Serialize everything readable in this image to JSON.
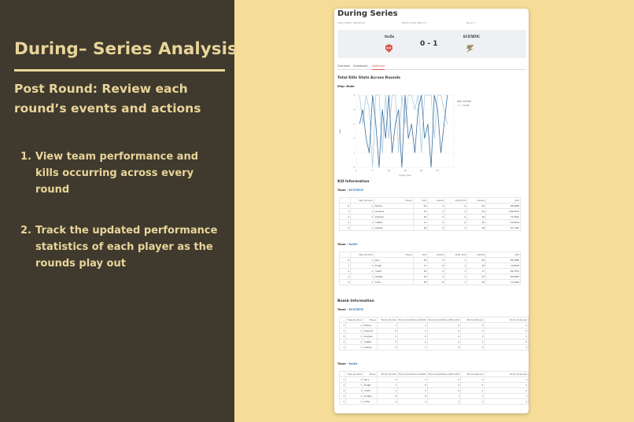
{
  "slide": {
    "title": "During– Series Analysis",
    "subtitle": "Post Round: Review each round’s events and actions",
    "bullets": [
      {
        "num": "1.",
        "text": "View team performance and kills occurring across every round"
      },
      {
        "num": "2.",
        "text": "Track the updated performance statistics of each player as the rounds play out"
      }
    ]
  },
  "app": {
    "page_title": "During Series",
    "meta": [
      "Date of Match: 2023-03-20",
      "Match Format: Best of 3",
      "Round: 3"
    ],
    "match": {
      "team1": "forZe",
      "team2": "ECSTATIC",
      "score": "0 - 1"
    },
    "tabs": [
      {
        "label": "Overhead",
        "active": false
      },
      {
        "label": "Scoreboard",
        "active": false
      },
      {
        "label": "Heatmaps",
        "active": true
      }
    ],
    "kills_section": "Total Kills Stats Across Rounds",
    "map_label": "Map: Nuke",
    "kill_info_heading": "Kill Information",
    "bomb_info_heading": "Bomb Information",
    "team_prefix": "Team -",
    "team_ecstatic": "ECSTATIC",
    "team_forze": "forZe",
    "kill_columns": [
      "",
      "Map_Number",
      "Player",
      "Kills",
      "Assists",
      "Multi_Kills",
      "Deaths",
      "ADR"
    ],
    "bomb_columns": [
      "Map_Number",
      "Player",
      "Bomb_Planted",
      "Bomb_DamStatus_WithAll",
      "Bomb_DamStatus_WithoutAll",
      "Bomb_Defused",
      "Bomb_Exploded"
    ],
    "kill_table_ecstatic": [
      [
        "0",
        "1",
        "Nodios",
        "22",
        "2",
        "2",
        "24",
        "96.0085"
      ],
      [
        "1",
        "1",
        "Queenix",
        "23",
        "2",
        "2",
        "22",
        "104.8073"
      ],
      [
        "2",
        "1",
        "kraghen",
        "16",
        "9",
        "0",
        "19",
        "72.2561"
      ],
      [
        "3",
        "1",
        "maNkz",
        "11",
        "5",
        "0",
        "20",
        "55.8533"
      ],
      [
        "4",
        "1",
        "salazar",
        "16",
        "0",
        "2",
        "16",
        "61.7467"
      ]
    ],
    "kill_table_forze": [
      [
        "0",
        "1",
        "Jerry",
        "24",
        "5",
        "1",
        "20",
        "89.3984"
      ],
      [
        "1",
        "1",
        "FinigE",
        "17",
        "8",
        "1",
        "18",
        "75.8533"
      ],
      [
        "2",
        "1",
        "r3salt",
        "18",
        "4",
        "1",
        "17",
        "66.7551"
      ],
      [
        "3",
        "1",
        "shalfey",
        "24",
        "9",
        "1",
        "15",
        "86.6087"
      ],
      [
        "4",
        "1",
        "zorte",
        "20",
        "8",
        "1",
        "19",
        "71.2461"
      ]
    ],
    "bomb_table_ecstatic": [
      [
        "1",
        "1",
        "Nodios",
        "1",
        "1",
        "0",
        "1",
        "0"
      ],
      [
        "1",
        "1",
        "Queenix",
        "6",
        "2",
        "0",
        "1",
        "0"
      ],
      [
        "1",
        "1",
        "kraghen",
        "2",
        "0",
        "0",
        "1",
        "1"
      ],
      [
        "1",
        "1",
        "maNkz",
        "2",
        "2",
        "0",
        "1",
        "0"
      ],
      [
        "1",
        "1",
        "salazar",
        "3",
        "1",
        "0",
        "1",
        "1"
      ]
    ],
    "bomb_table_forze": [
      [
        "1",
        "1",
        "Jerry",
        "1",
        "1",
        "0",
        "1",
        "1"
      ],
      [
        "1",
        "1",
        "FinigE",
        "1",
        "8",
        "0",
        "0",
        "1"
      ],
      [
        "1",
        "1",
        "r3salt",
        "1",
        "1",
        "0",
        "1",
        "6"
      ],
      [
        "1",
        "1",
        "shalfey",
        "4",
        "8",
        "1",
        "1",
        "1"
      ],
      [
        "1",
        "1",
        "zorte",
        "4",
        "4",
        "1",
        "1",
        "1"
      ]
    ]
  },
  "chart_data": {
    "type": "line",
    "title": "",
    "xlabel": "round_num",
    "ylabel": "kills",
    "xlim": [
      0,
      30
    ],
    "ylim": [
      0,
      5
    ],
    "xticks": [
      0,
      5,
      10,
      15,
      20,
      25
    ],
    "yticks": [
      0,
      1,
      2,
      3,
      4,
      5
    ],
    "legend_position": "right",
    "x": [
      1,
      2,
      3,
      4,
      5,
      6,
      7,
      8,
      9,
      10,
      11,
      12,
      13,
      14,
      15,
      16,
      17,
      18,
      19,
      20,
      21,
      22,
      23,
      24,
      25,
      26,
      27,
      28
    ],
    "series": [
      {
        "name": "ECSTATIC",
        "color": "#3d6f9e",
        "values": [
          3,
          4,
          2,
          1,
          5,
          3,
          0,
          4,
          2,
          5,
          1,
          3,
          4,
          0,
          5,
          2,
          3,
          1,
          4,
          5,
          2,
          3,
          0,
          5,
          4,
          1,
          3,
          5
        ]
      },
      {
        "name": "forZe",
        "color": "#a9cce3",
        "values": [
          5,
          3,
          5,
          4,
          0,
          5,
          5,
          1,
          5,
          2,
          5,
          5,
          1,
          5,
          3,
          5,
          5,
          4,
          5,
          1,
          5,
          5,
          5,
          2,
          5,
          5,
          4,
          3
        ]
      }
    ]
  }
}
